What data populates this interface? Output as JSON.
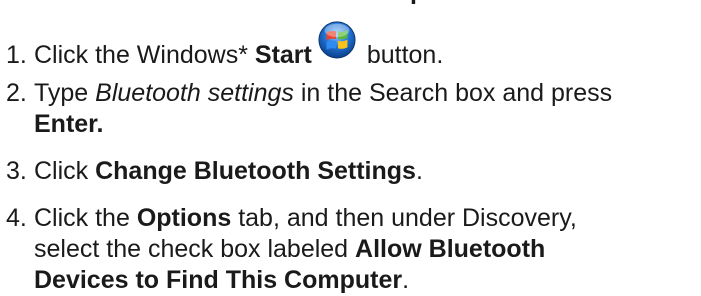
{
  "heading_fragment": "p",
  "steps": [
    {
      "number": "1.",
      "parts": {
        "a": "Click the Windows* ",
        "b": "Start",
        "c": " button."
      },
      "icon": "windows-start-orb-icon"
    },
    {
      "number": "2.",
      "parts": {
        "a": "Type ",
        "b": "Bluetooth settings",
        "c": " in the Search box and press",
        "d": "Enter."
      }
    },
    {
      "number": "3.",
      "parts": {
        "a": "Click ",
        "b": "Change Bluetooth Settings",
        "c": "."
      }
    },
    {
      "number": "4.",
      "parts": {
        "a": "Click the ",
        "b": "Options",
        "c": " tab, and then under Discovery,",
        "d": "select the check box labeled ",
        "e": "Allow Bluetooth",
        "f": "Devices to Find This Computer",
        "g": "."
      }
    }
  ],
  "colors": {
    "text": "#1a1a1a",
    "logo_blue": "#1f6fd0",
    "logo_red": "#e8442c",
    "logo_green": "#57b83a",
    "logo_yellow": "#f6c21b"
  }
}
